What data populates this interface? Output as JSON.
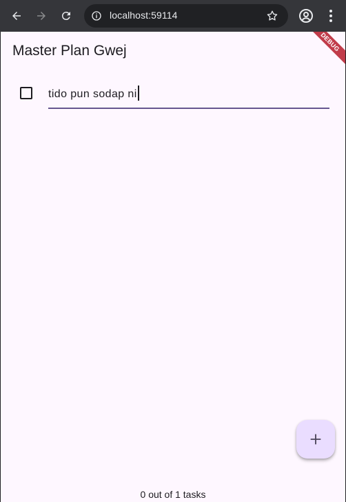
{
  "browser": {
    "url": "localhost:59114",
    "icons": {
      "back": "back-arrow-icon",
      "forward": "forward-arrow-icon",
      "reload": "reload-icon",
      "site_info": "info-icon",
      "bookmark": "star-icon",
      "profile": "profile-icon",
      "menu": "kebab-menu-icon"
    }
  },
  "app": {
    "title": "Master Plan Gwej",
    "debug_banner": "DEBUG",
    "tasks": [
      {
        "description": "tido pun sodap ni",
        "complete": false
      }
    ],
    "fab_icon": "add-icon",
    "status": "0 out of 1 tasks",
    "colors": {
      "background": "#fef7ff",
      "fab": "#eaddff",
      "underline": "#65558f",
      "text": "#1d1b20"
    }
  }
}
